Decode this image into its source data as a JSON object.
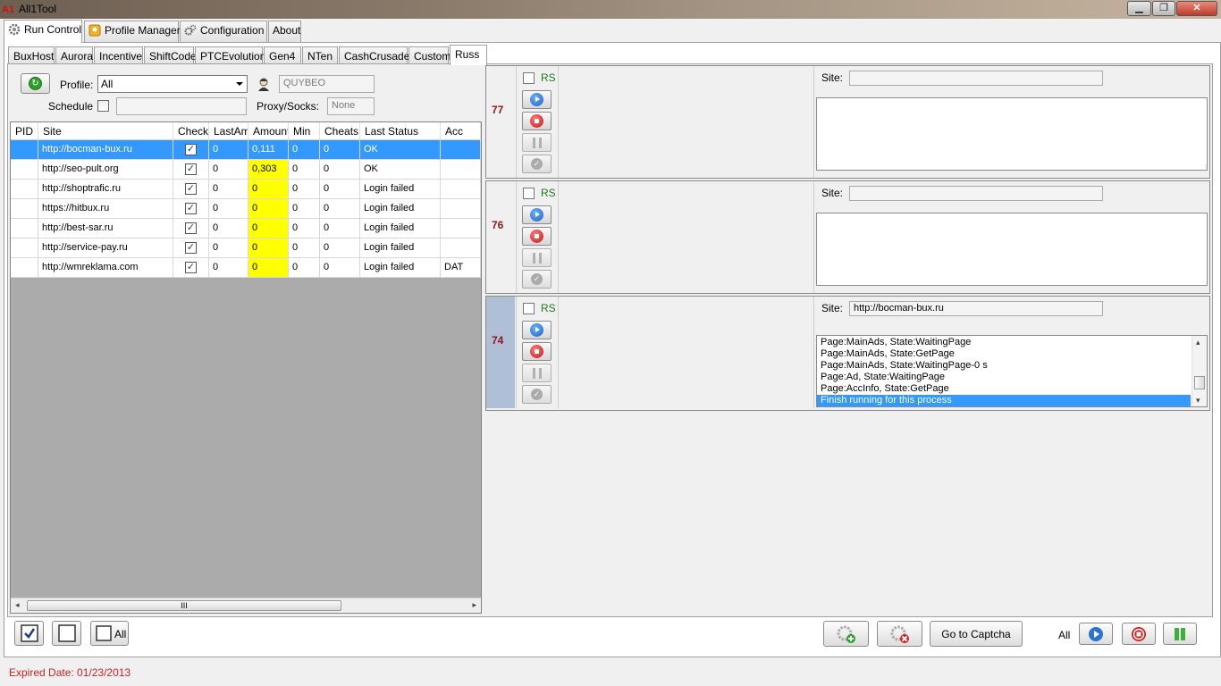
{
  "window": {
    "title": "All1Tool",
    "icon_text": "A1",
    "minimize": "▁",
    "maximize": "❐",
    "close": "✕"
  },
  "main_tabs": [
    {
      "label": "Run Control",
      "icon": "gear-icon"
    },
    {
      "label": "Profile Manager",
      "icon": "profile-manager-icon"
    },
    {
      "label": "Configuration",
      "icon": "configuration-icon"
    },
    {
      "label": "About"
    }
  ],
  "sub_tabs": [
    "BuxHost",
    "Aurora",
    "Incentive",
    "ShiftCode",
    "PTCEvolution",
    "Gen4",
    "NTen",
    "CashCrusader",
    "Custom",
    "Russ"
  ],
  "controls": {
    "profile_label": "Profile:",
    "profile_value": "All",
    "user_value": "QUYBEO",
    "schedule_label": "Schedule",
    "proxy_label": "Proxy/Socks:",
    "proxy_value": "None"
  },
  "grid": {
    "columns": [
      "PID",
      "Site",
      "Check",
      "LastAm",
      "Amount",
      "Min",
      "Cheats",
      "Last Status",
      "Acc"
    ],
    "rows": [
      {
        "pid": "",
        "site": "http://bocman-bux.ru",
        "checked": "✓",
        "lastam": "0",
        "amount": "0,111",
        "min": "0",
        "cheats": "0",
        "status": "OK",
        "acc": ""
      },
      {
        "pid": "",
        "site": "http://seo-pult.org",
        "checked": "✓",
        "lastam": "0",
        "amount": "0,303",
        "min": "0",
        "cheats": "0",
        "status": "OK",
        "acc": ""
      },
      {
        "pid": "",
        "site": "http://shoptrafic.ru",
        "checked": "✓",
        "lastam": "0",
        "amount": "0",
        "min": "0",
        "cheats": "0",
        "status": "Login failed",
        "acc": ""
      },
      {
        "pid": "",
        "site": "https://hitbux.ru",
        "checked": "✓",
        "lastam": "0",
        "amount": "0",
        "min": "0",
        "cheats": "0",
        "status": "Login failed",
        "acc": ""
      },
      {
        "pid": "",
        "site": "http://best-sar.ru",
        "checked": "✓",
        "lastam": "0",
        "amount": "0",
        "min": "0",
        "cheats": "0",
        "status": "Login failed",
        "acc": ""
      },
      {
        "pid": "",
        "site": "http://service-pay.ru",
        "checked": "✓",
        "lastam": "0",
        "amount": "0",
        "min": "0",
        "cheats": "0",
        "status": "Login failed",
        "acc": ""
      },
      {
        "pid": "",
        "site": "http://wmreklama.com",
        "checked": "✓",
        "lastam": "0",
        "amount": "0",
        "min": "0",
        "cheats": "0",
        "status": "Login failed",
        "acc": "DAT"
      }
    ],
    "scroll_grip": "III",
    "scroll_left": "◂",
    "scroll_right": "▸"
  },
  "processes": [
    {
      "id": "77",
      "rs_label": "RS",
      "site_label": "Site:",
      "site_value": "",
      "log": []
    },
    {
      "id": "76",
      "rs_label": "RS",
      "site_label": "Site:",
      "site_value": "",
      "log": []
    },
    {
      "id": "74",
      "rs_label": "RS",
      "site_label": "Site:",
      "site_value": "http://bocman-bux.ru",
      "log": [
        "Page:MainAds, State:WaitingPage",
        "Page:MainAds, State:GetPage",
        "Page:MainAds, State:WaitingPage-0 s",
        "Page:Ad, State:WaitingPage",
        "Page:AccInfo, State:GetPage",
        "Finish running for this process"
      ]
    }
  ],
  "bottom": {
    "all_label": "All",
    "captcha_label": "Go to Captcha",
    "all_right_label": "All"
  },
  "status": {
    "expired": "Expired Date: 01/23/2013"
  },
  "colors": {
    "accent": "#3399ff",
    "amount_highlight": "#ffff00",
    "expired_text": "#d42020",
    "process_id": "#8b1a1a",
    "rs_text": "#1e7a1e"
  }
}
